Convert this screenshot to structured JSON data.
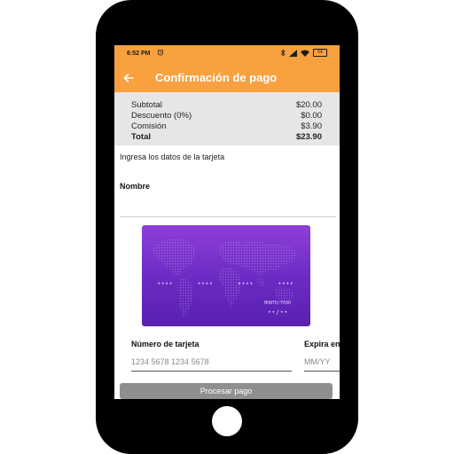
{
  "status_bar": {
    "time": "6:52 PM",
    "battery": "64"
  },
  "app_bar": {
    "title": "Confirmación de pago"
  },
  "summary": [
    {
      "label": "Subtotal",
      "value": "$20.00"
    },
    {
      "label": "Descuento (0%)",
      "value": "$0.00"
    },
    {
      "label": "Comisión",
      "value": "$3.90"
    },
    {
      "label": "Total",
      "value": "$23.90"
    }
  ],
  "form": {
    "instruction": "Ingresa los datos de la tarjeta",
    "name_label": "Nombre",
    "name_value": "",
    "card_number_label": "Número de tarjeta",
    "card_number_placeholder": "1234 5678 1234 5678",
    "card_number_value": "",
    "expiry_label": "Expira en",
    "expiry_placeholder": "MM/YY",
    "expiry_value": "",
    "submit_label": "Procesar pago"
  },
  "card_preview": {
    "number_groups": [
      "••••",
      "••••",
      "••••",
      "••••"
    ],
    "month_year_label": "MONTH/YEAR",
    "expiry_mask": "••/••"
  },
  "colors": {
    "accent": "#f9a03f",
    "card": "#7530c9",
    "summary_bg": "#e6e6e6",
    "button_disabled": "#8f8f8f"
  },
  "icons": {
    "back": "arrow-back-icon",
    "alarm": "alarm-icon",
    "bluetooth": "bluetooth-icon",
    "signal": "signal-icon",
    "wifi": "wifi-icon",
    "battery": "battery-icon"
  }
}
